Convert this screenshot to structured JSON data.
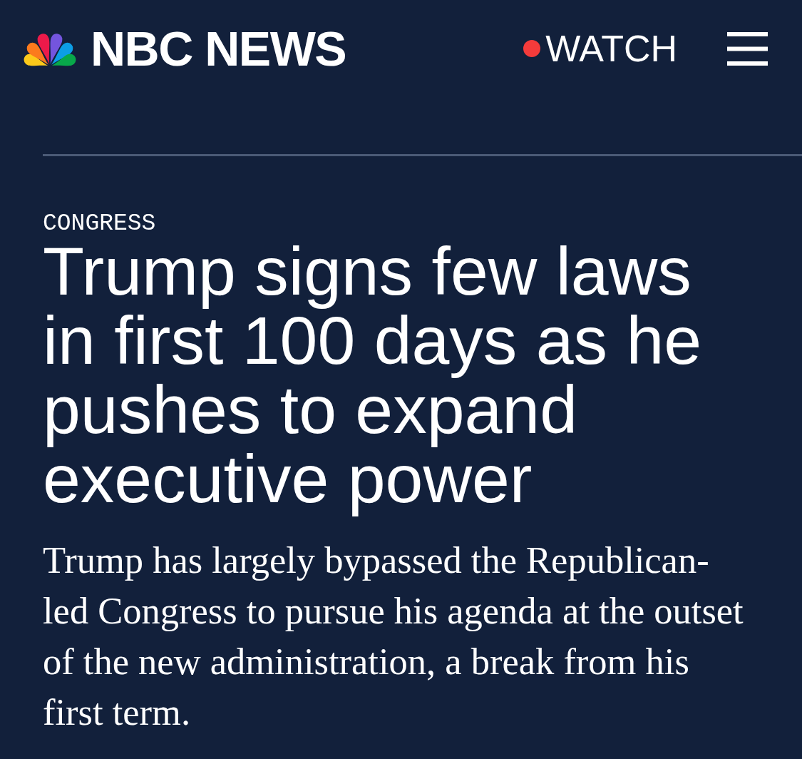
{
  "header": {
    "logo_text": "NBC NEWS",
    "watch_label": "WATCH"
  },
  "article": {
    "section": "CONGRESS",
    "headline": "Trump signs few laws in first 100 days as he pushes to expand executive power",
    "dek": "Trump has largely bypassed the Republican-led Congress to pursue his agenda at the outset of the new administration, a break from his first term."
  }
}
